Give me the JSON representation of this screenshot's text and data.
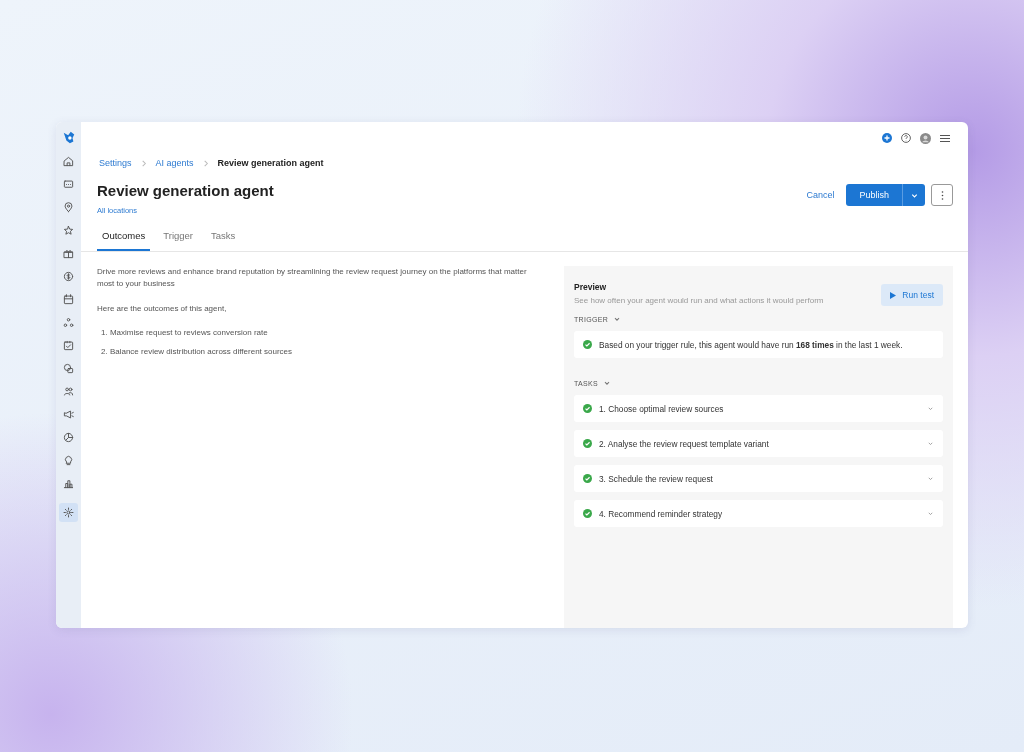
{
  "sidebar": {
    "items": [
      {
        "selected": false
      },
      {
        "selected": false
      },
      {
        "selected": false
      },
      {
        "selected": false
      },
      {
        "selected": false
      },
      {
        "selected": false
      },
      {
        "selected": false
      },
      {
        "selected": false
      },
      {
        "selected": false
      },
      {
        "selected": false
      },
      {
        "selected": false
      },
      {
        "selected": false
      },
      {
        "selected": false
      },
      {
        "selected": false
      },
      {
        "selected": false
      },
      {
        "selected": true
      }
    ]
  },
  "breadcrumb": [
    {
      "label": "Settings",
      "current": false
    },
    {
      "label": "AI agents",
      "current": false
    },
    {
      "label": "Review generation agent",
      "current": true
    }
  ],
  "header": {
    "title": "Review generation agent",
    "subtitle": "All locations"
  },
  "actions": {
    "cancel": "Cancel",
    "publish": "Publish"
  },
  "tabs": [
    {
      "label": "Outcomes",
      "selected": true
    },
    {
      "label": "Trigger",
      "selected": false
    },
    {
      "label": "Tasks",
      "selected": false
    }
  ],
  "outcomes": {
    "intro": "Drive more reviews and enhance brand reputation by streamlining the review request journey on the platforms that matter most to your business",
    "lead": "Here are the outcomes of this agent,",
    "items": [
      "1. Maximise request to reviews conversion rate",
      "2. Balance review distribution across different sources"
    ]
  },
  "preview": {
    "title": "Preview",
    "subtitle": "See how often your agent would run and what actions it would perform",
    "run_button": "Run test",
    "trigger": {
      "heading": "TRIGGER",
      "message": "Based on your trigger rule, this agent would have run **168 times** in the last 1 week."
    },
    "tasks": {
      "heading": "TASKS",
      "items": [
        {
          "label": "1. Choose optimal review sources"
        },
        {
          "label": "2. Analyse the review request template variant"
        },
        {
          "label": "3. Schedule the review request"
        },
        {
          "label": "4. Recommend reminder strategy"
        }
      ]
    }
  }
}
